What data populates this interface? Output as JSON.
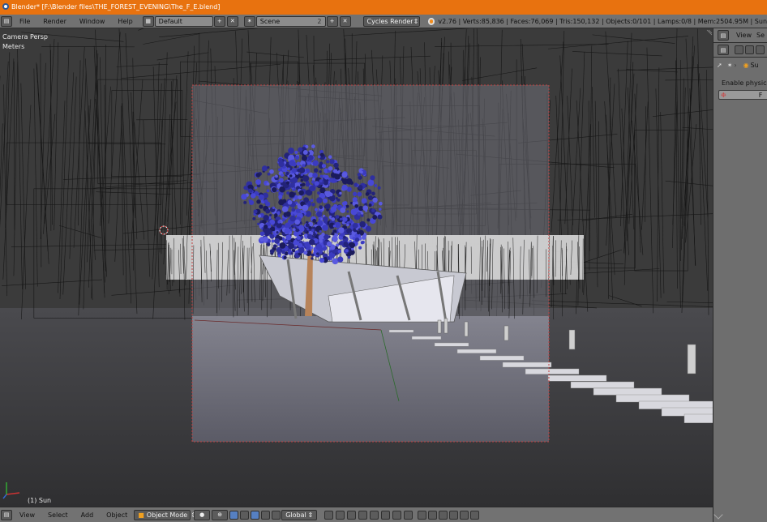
{
  "window": {
    "title": "Blender* [F:\\Blender files\\THE_FOREST_EVENING\\The_F_E.blend]"
  },
  "infobar": {
    "menus": [
      "File",
      "Render",
      "Window",
      "Help"
    ],
    "screen_layout": "Default",
    "scene": "Scene",
    "scene_users": "2",
    "render_engine": "Cycles Render",
    "stats": "v2.76 | Verts:85,836 | Faces:76,069 | Tris:150,132 | Objects:0/101 | Lamps:0/8 | Mem:2504.95M | Sun"
  },
  "viewport": {
    "view_name": "Camera Persp",
    "units": "Meters",
    "active_object": "(1) Sun"
  },
  "footer": {
    "menus": [
      "View",
      "Select",
      "Add",
      "Object"
    ],
    "mode": "Object Mode",
    "orientation": "Global"
  },
  "properties_panel": {
    "header_menus": [
      "View",
      "Se"
    ],
    "context_label": "Su",
    "physics_text": "Enable physics for",
    "button_text": "F"
  },
  "colors": {
    "title_bar": "#e8720f",
    "header": "#727272",
    "viewport_bg": "#3b3b3b",
    "camera_frame": "#c04040",
    "tree_foliage": "#3a3aa8"
  }
}
